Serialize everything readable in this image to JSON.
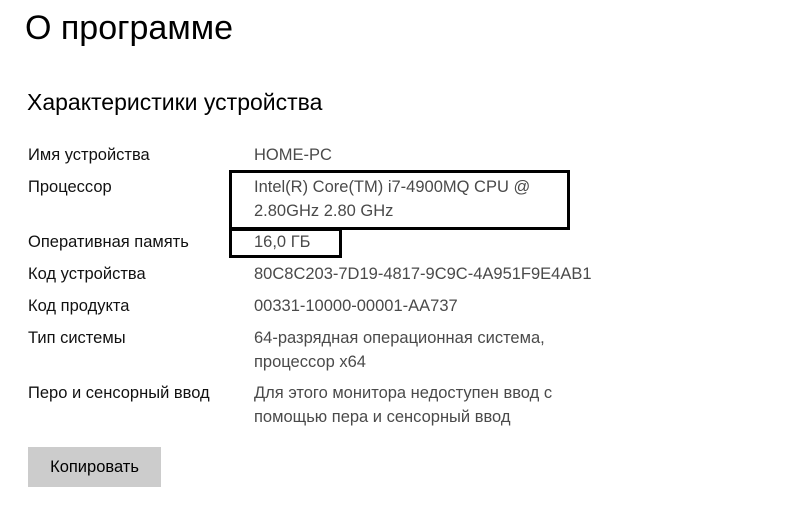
{
  "page_title": "О программе",
  "section_title": "Характеристики устройства",
  "specs": {
    "device_name": {
      "label": "Имя устройства",
      "value": "HOME-PC"
    },
    "processor": {
      "label": "Процессор",
      "value_line1": "Intel(R) Core(TM) i7-4900MQ CPU @",
      "value_line2": "2.80GHz   2.80 GHz"
    },
    "ram": {
      "label": "Оперативная память",
      "value": "16,0 ГБ"
    },
    "device_id": {
      "label": "Код устройства",
      "value": "80C8C203-7D19-4817-9C9C-4A951F9E4AB1"
    },
    "product_id": {
      "label": "Код продукта",
      "value": "00331-10000-00001-AA737"
    },
    "system_type": {
      "label": "Тип системы",
      "value_line1": "64-разрядная операционная система,",
      "value_line2": "процессор x64"
    },
    "pen_touch": {
      "label": "Перо и сенсорный ввод",
      "value_line1": "Для этого монитора недоступен ввод с",
      "value_line2": "помощью пера и сенсорный ввод"
    }
  },
  "copy_button_label": "Копировать"
}
